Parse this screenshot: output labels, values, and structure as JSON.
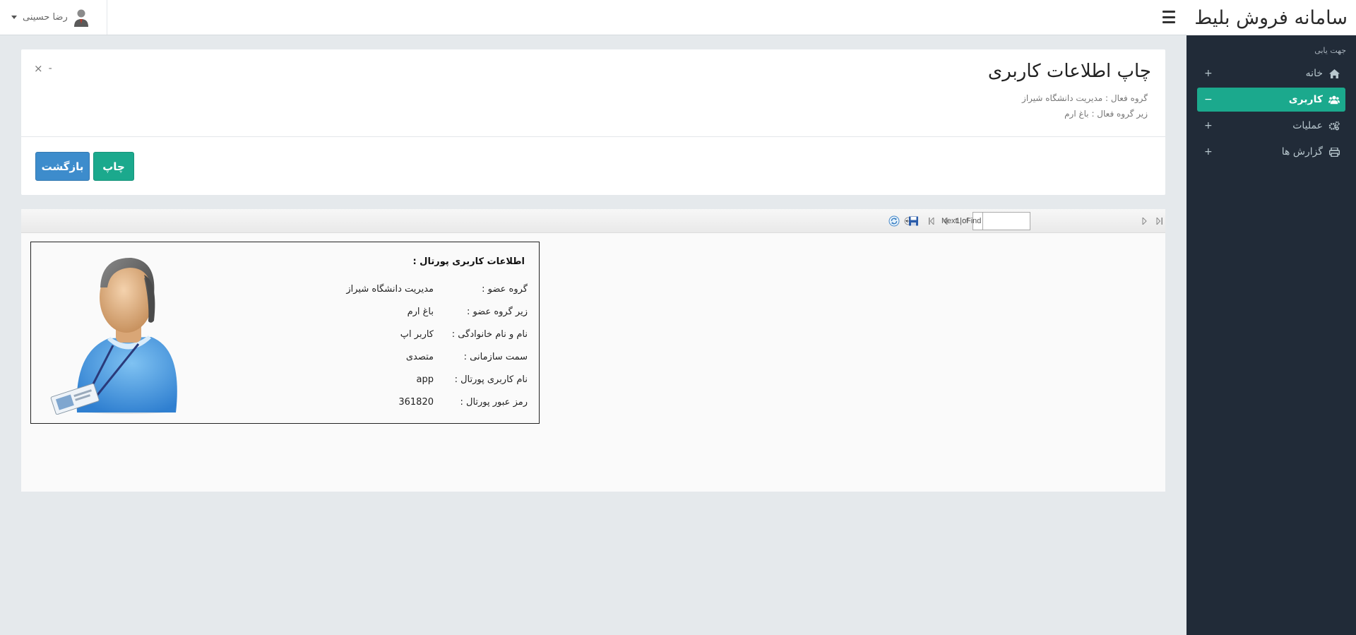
{
  "brand": {
    "title": "سامانه فروش بلیط"
  },
  "header": {
    "user_name": "رضا حسینی"
  },
  "sidebar": {
    "heading": "جهت یابی",
    "items": [
      {
        "label": "خانه",
        "icon": "home-icon",
        "toggle": "+",
        "active": false
      },
      {
        "label": "کاربری",
        "icon": "users-icon",
        "toggle": "−",
        "active": true
      },
      {
        "label": "عملیات",
        "icon": "gears-icon",
        "toggle": "+",
        "active": false
      },
      {
        "label": "گزارش ها",
        "icon": "print-icon",
        "toggle": "+",
        "active": false
      }
    ]
  },
  "panel": {
    "title": "چاپ اطلاعات کاربری",
    "active_group": "گروه فعال : مدیریت دانشگاه شیراز",
    "active_subgroup": "زیر گروه فعال : باغ ارم",
    "close_symbol": "×",
    "minimize_symbol": "-",
    "print_button": "چاپ",
    "back_button": "بازگشت"
  },
  "viewer": {
    "page_current": "1",
    "page_of": "1 of",
    "find_label": "Find",
    "separator": "|",
    "next_label": "Next",
    "find_value": ""
  },
  "report": {
    "title": "اطلاعات کاربری پورتال :",
    "fields": [
      {
        "label": "گروه عضو :",
        "value": "مدیریت دانشگاه شیراز"
      },
      {
        "label": "زیر گروه عضو :",
        "value": "باغ ارم"
      },
      {
        "label": "نام و نام خانوادگی :",
        "value": "کاربر اپ"
      },
      {
        "label": "سمت سازمانی :",
        "value": "متصدی"
      },
      {
        "label": "نام کاربری پورتال :",
        "value": "app"
      },
      {
        "label": "رمز عبور پورتال :",
        "value": "361820"
      }
    ]
  },
  "colors": {
    "sidebar_bg": "#212b38",
    "active_item": "#1ba98d",
    "back_button": "#3d8ccc",
    "page_bg": "#e5e9ec"
  }
}
